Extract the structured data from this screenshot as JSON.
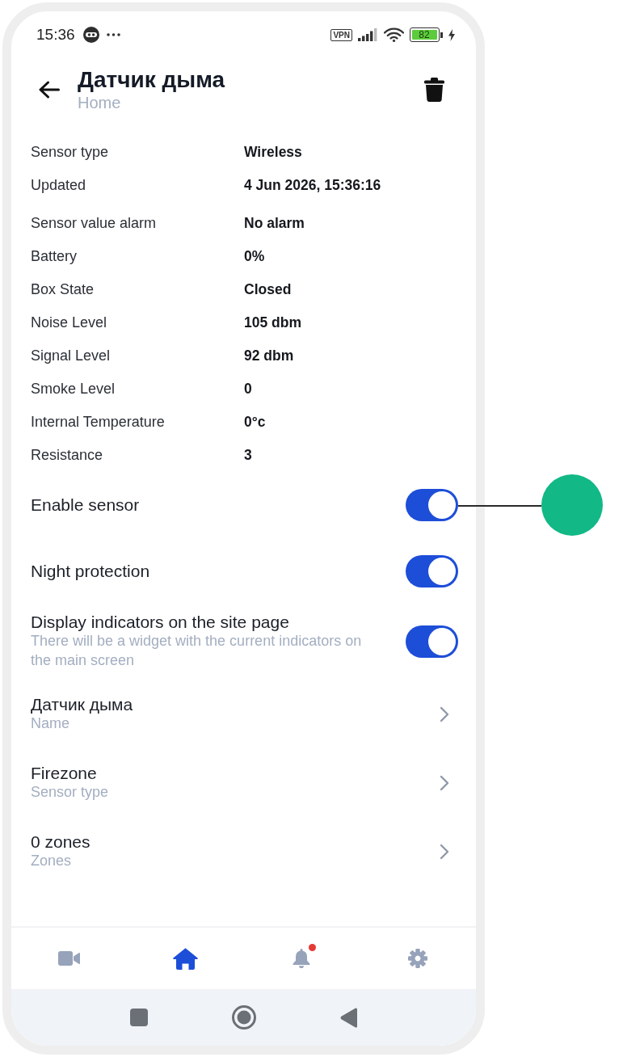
{
  "status_bar": {
    "time": "15:36",
    "vpn": "VPN",
    "battery": "82"
  },
  "header": {
    "title": "Датчик дыма",
    "subtitle": "Home"
  },
  "detail_groups": [
    [
      {
        "label": "Sensor type",
        "value": "Wireless"
      },
      {
        "label": "Updated",
        "value": "4 Jun 2026, 15:36:16"
      }
    ],
    [
      {
        "label": "Sensor value alarm",
        "value": "No alarm"
      },
      {
        "label": "Battery",
        "value": "0%"
      },
      {
        "label": "Box State",
        "value": "Closed"
      },
      {
        "label": "Noise Level",
        "value": "105 dbm"
      },
      {
        "label": "Signal Level",
        "value": "92 dbm"
      },
      {
        "label": "Smoke Level",
        "value": "0"
      },
      {
        "label": "Internal Temperature",
        "value": "0°c"
      },
      {
        "label": "Resistance",
        "value": "3"
      }
    ]
  ],
  "toggles": [
    {
      "label": "Enable sensor",
      "on": true
    },
    {
      "label": "Night protection",
      "on": true
    },
    {
      "label": "Display indicators on the site page",
      "description": "There will be a widget with the current indicators on the main screen",
      "on": true
    }
  ],
  "links": [
    {
      "title": "Датчик дыма",
      "subtitle": "Name"
    },
    {
      "title": "Firezone",
      "subtitle": "Sensor type"
    },
    {
      "title": "0 zones",
      "subtitle": "Zones"
    }
  ],
  "bottom_nav": [
    {
      "kind": "camera",
      "selected": false,
      "alert": false
    },
    {
      "kind": "home",
      "selected": true,
      "alert": false
    },
    {
      "kind": "bell",
      "selected": false,
      "alert": true
    },
    {
      "kind": "settings",
      "selected": false,
      "alert": false
    }
  ],
  "system_nav": [
    {
      "kind": "recents"
    },
    {
      "kind": "home"
    },
    {
      "kind": "back"
    }
  ]
}
